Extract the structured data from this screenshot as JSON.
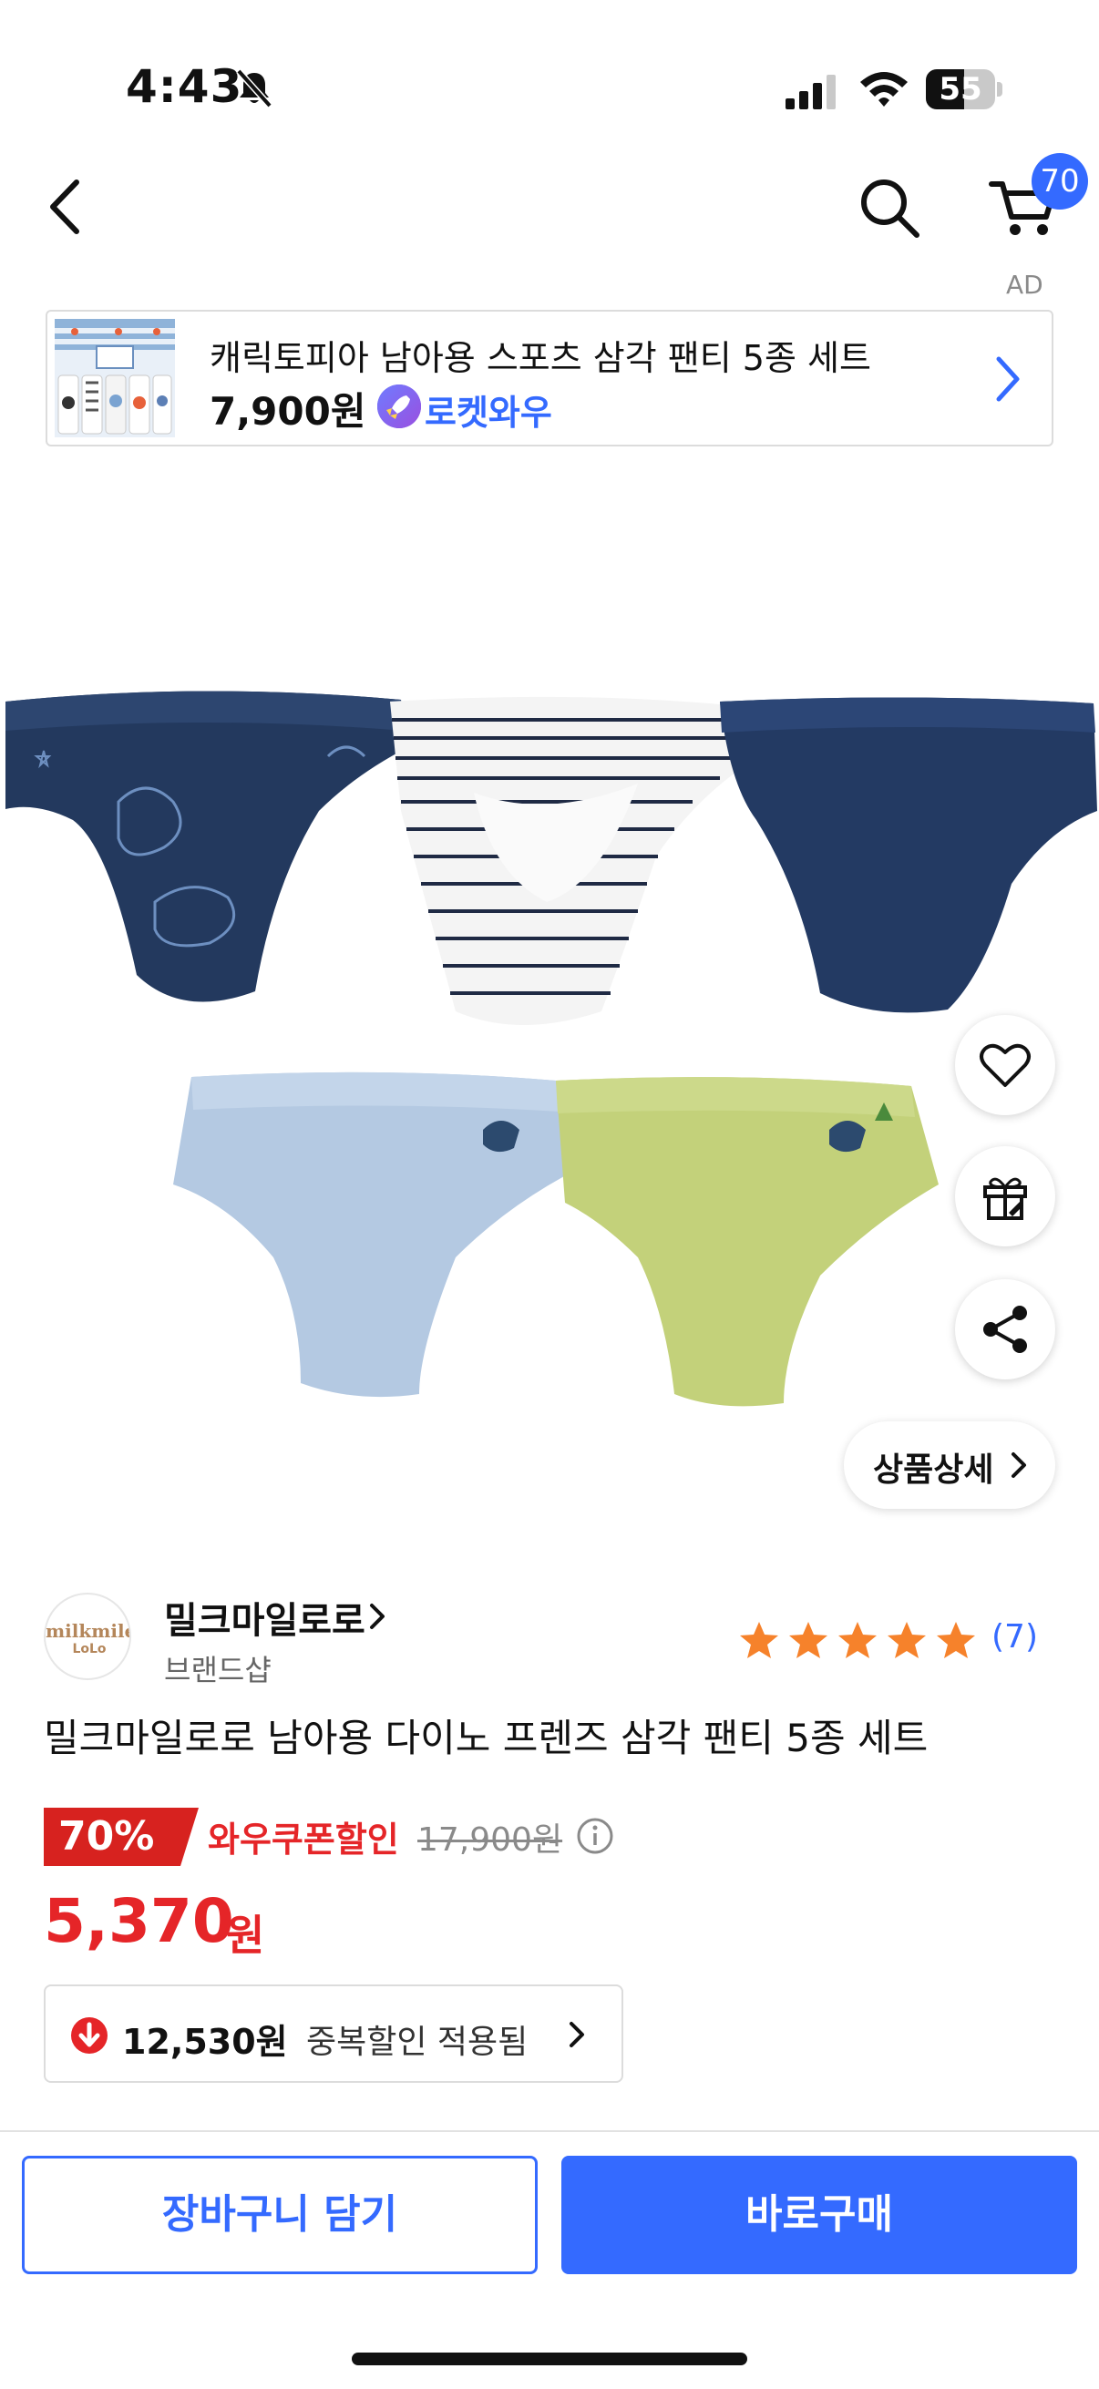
{
  "status_bar": {
    "time": "4:43",
    "battery_level": "55",
    "icons": [
      "bell-slash-icon",
      "signal-icon",
      "wifi-icon",
      "battery-icon"
    ]
  },
  "nav": {
    "cart_badge": "70",
    "icons": [
      "chevron-left-icon",
      "search-icon",
      "cart-icon"
    ]
  },
  "ad": {
    "label": "AD",
    "title": "캐릭토피아 남아용 스포츠 삼각 팬티 5종 세트",
    "price": "7,900원",
    "badge_text": "로켓와우"
  },
  "product_image": {
    "items": [
      "navy dino print brief",
      "white striped brief",
      "solid navy brief",
      "light blue dino brief",
      "lime green dino brief"
    ]
  },
  "floating_actions": {
    "detail_label": "상품상세"
  },
  "brand": {
    "logo_line1": "milkmile",
    "logo_line2": "LoLo",
    "name": "밀크마일로로",
    "subtitle": "브랜드샵",
    "rating": 5,
    "review_count": "(7)"
  },
  "product": {
    "title": "밀크마일로로 남아용 다이노 프렌즈 삼각 팬티 5종 세트"
  },
  "price": {
    "discount_rate": "70%",
    "coupon_label": "와우쿠폰할인",
    "original_price": "17,900원",
    "sale_price": "5,370",
    "sale_unit": "원",
    "stacked_discount_amount": "12,530원",
    "stacked_discount_text": "중복할인 적용됨"
  },
  "bottom_bar": {
    "add_to_cart": "장바구니 담기",
    "buy_now": "바로구매"
  },
  "colors": {
    "accent_blue": "#346aff",
    "sale_red": "#e52528"
  }
}
